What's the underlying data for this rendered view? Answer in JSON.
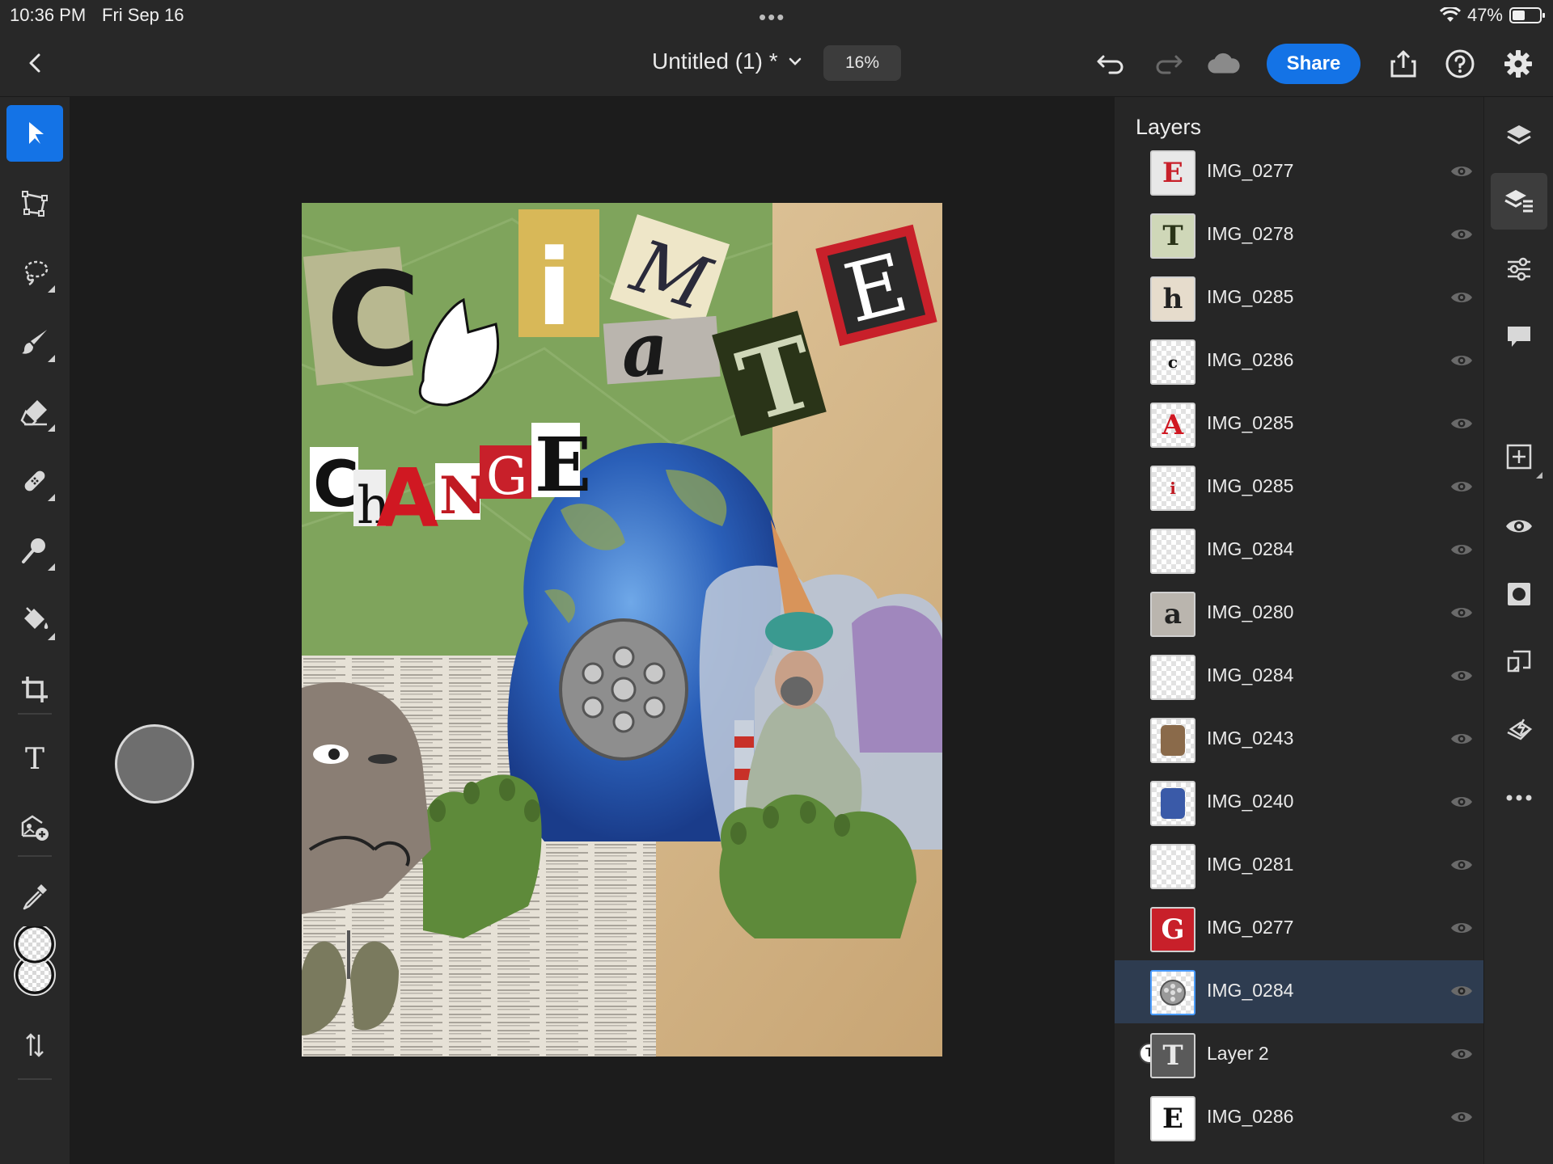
{
  "status_bar": {
    "time": "10:36 PM",
    "date": "Fri Sep 16",
    "battery_text": "47%",
    "battery_level": 0.47
  },
  "header": {
    "doc_title": "Untitled (1) *",
    "zoom": "16%",
    "share_label": "Share"
  },
  "left_tools": [
    {
      "name": "select-tool",
      "icon": "arrow-pointer-icon",
      "active": true
    },
    {
      "name": "transform-tool",
      "icon": "transform-icon"
    },
    {
      "name": "lasso-tool",
      "icon": "lasso-icon"
    },
    {
      "name": "brush-tool",
      "icon": "brush-icon"
    },
    {
      "name": "eraser-tool",
      "icon": "eraser-icon"
    },
    {
      "name": "healing-tool",
      "icon": "bandage-icon"
    },
    {
      "name": "clone-tool",
      "icon": "clone-stamp-icon"
    },
    {
      "name": "fill-tool",
      "icon": "paint-bucket-icon"
    },
    {
      "name": "crop-tool",
      "icon": "crop-icon"
    },
    {
      "name": "type-tool",
      "icon": "type-icon",
      "glyph": "T"
    },
    {
      "name": "place-image-tool",
      "icon": "add-image-icon"
    },
    {
      "name": "eyedropper-tool",
      "icon": "eyedropper-icon"
    }
  ],
  "layers_panel": {
    "title": "Layers",
    "layers": [
      {
        "name": "IMG_0277",
        "thumb": "E",
        "thumb_color": "#c8202a",
        "thumb_bg": "#e8e8e8"
      },
      {
        "name": "IMG_0278",
        "thumb": "T",
        "thumb_color": "#2a3418",
        "thumb_bg": "#cfd7b8"
      },
      {
        "name": "IMG_0285",
        "thumb": "h",
        "thumb_color": "#222222",
        "thumb_bg": "#e6dccc"
      },
      {
        "name": "IMG_0286",
        "thumb": "c",
        "thumb_color": "#111111",
        "thumb_bg": ""
      },
      {
        "name": "IMG_0285",
        "thumb": "A",
        "thumb_color": "#d01822",
        "thumb_bg": ""
      },
      {
        "name": "IMG_0285",
        "thumb": "i",
        "thumb_color": "#c01a22",
        "thumb_bg": ""
      },
      {
        "name": "IMG_0284",
        "thumb": "",
        "thumb_color": "#888888",
        "thumb_bg": ""
      },
      {
        "name": "IMG_0280",
        "thumb": "a",
        "thumb_color": "#222222",
        "thumb_bg": "#bab5ae"
      },
      {
        "name": "IMG_0284",
        "thumb": "",
        "thumb_color": "#888888",
        "thumb_bg": ""
      },
      {
        "name": "IMG_0243",
        "thumb": "",
        "thumb_color": "#8a6a4a",
        "thumb_bg": ""
      },
      {
        "name": "IMG_0240",
        "thumb": "",
        "thumb_color": "#3a5aa8",
        "thumb_bg": ""
      },
      {
        "name": "IMG_0281",
        "thumb": "",
        "thumb_color": "#888888",
        "thumb_bg": ""
      },
      {
        "name": "IMG_0277",
        "thumb": "G",
        "thumb_color": "#ffffff",
        "thumb_bg": "#c8202a"
      },
      {
        "name": "IMG_0284",
        "thumb": "",
        "thumb_color": "#9a9a9a",
        "thumb_bg": "",
        "selected": true
      },
      {
        "name": "Layer 2",
        "thumb": "T",
        "thumb_color": "#e8e8e8",
        "thumb_bg": "#5a5a5a",
        "text_layer": true
      },
      {
        "name": "IMG_0286",
        "thumb": "E",
        "thumb_color": "#111111",
        "thumb_bg": "#ffffff"
      }
    ]
  },
  "right_rail": [
    {
      "name": "layers-panel-button",
      "icon": "layers-icon"
    },
    {
      "name": "layer-properties-button",
      "icon": "layer-properties-icon",
      "active": true
    },
    {
      "name": "adjustments-button",
      "icon": "sliders-icon"
    },
    {
      "name": "comments-button",
      "icon": "comment-icon"
    },
    {
      "name": "add-layer-button",
      "icon": "plus-square-icon"
    },
    {
      "name": "visibility-button",
      "icon": "eye-icon"
    },
    {
      "name": "mask-button",
      "icon": "mask-icon"
    },
    {
      "name": "clip-button",
      "icon": "clip-icon"
    },
    {
      "name": "arrange-button",
      "icon": "arrange-icon"
    },
    {
      "name": "more-button",
      "icon": "more-icon"
    }
  ],
  "artwork": {
    "letters": {
      "C": "C",
      "i": "i",
      "M": "M",
      "E": "E",
      "a": "a",
      "T": "T",
      "change": [
        "C",
        "h",
        "A",
        "N",
        "G",
        "E"
      ],
      "small_change": [
        "h",
        "A"
      ]
    }
  },
  "colors": {
    "accent": "#1473e6",
    "panel": "#262626",
    "selected_row": "#2e3c50"
  }
}
